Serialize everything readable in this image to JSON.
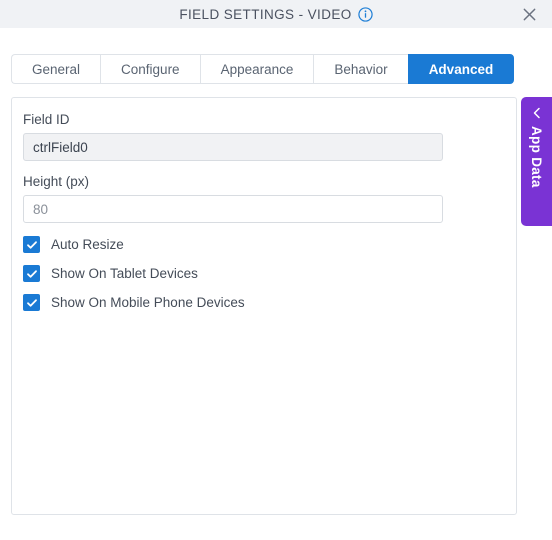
{
  "dialog": {
    "title": "FIELD SETTINGS - VIDEO",
    "info_icon": "info-circle-icon",
    "close_icon": "close-icon"
  },
  "tabs": [
    {
      "label": "General",
      "active": false
    },
    {
      "label": "Configure",
      "active": false
    },
    {
      "label": "Appearance",
      "active": false
    },
    {
      "label": "Behavior",
      "active": false
    },
    {
      "label": "Advanced",
      "active": true
    }
  ],
  "form": {
    "field_id": {
      "label": "Field ID",
      "value": "ctrlField0",
      "placeholder": ""
    },
    "height": {
      "label": "Height (px)",
      "value": "",
      "placeholder": "80"
    },
    "checkboxes": [
      {
        "label": "Auto Resize",
        "checked": true
      },
      {
        "label": "Show On Tablet Devices",
        "checked": true
      },
      {
        "label": "Show On Mobile Phone Devices",
        "checked": true
      }
    ]
  },
  "app_data_tab": {
    "label": "App Data",
    "chevron_icon": "chevron-left-icon"
  },
  "colors": {
    "accent_blue": "#1a7ad4",
    "app_data_purple": "#7a33d4",
    "titlebar_bg": "#f0f2f5",
    "border": "#dfe3e8",
    "text": "#444c58"
  }
}
